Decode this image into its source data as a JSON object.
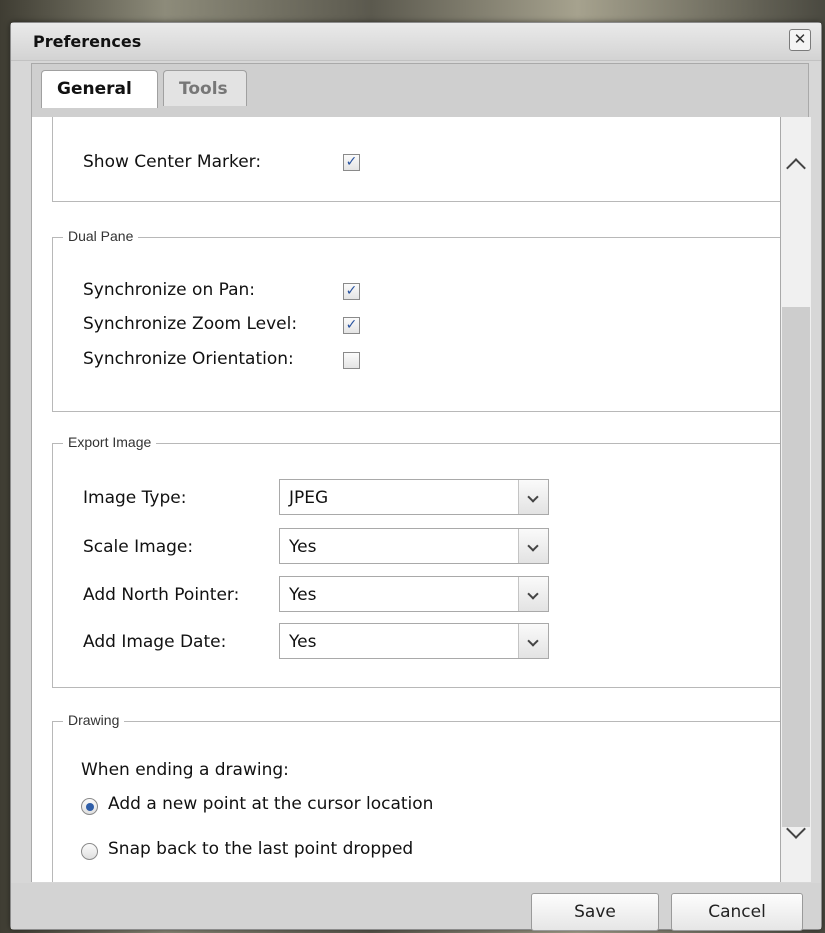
{
  "dialog": {
    "title": "Preferences",
    "close_glyph": "✕"
  },
  "tabs": [
    {
      "label": "General",
      "active": true
    },
    {
      "label": "Tools",
      "active": false
    }
  ],
  "general": {
    "show_center_marker": {
      "label": "Show Center Marker:",
      "checked": true
    }
  },
  "dual_pane": {
    "legend": "Dual Pane",
    "options": [
      {
        "label": "Synchronize on Pan:",
        "checked": true
      },
      {
        "label": "Synchronize Zoom Level:",
        "checked": true
      },
      {
        "label": "Synchronize Orientation:",
        "checked": false
      }
    ]
  },
  "export_image": {
    "legend": "Export Image",
    "fields": [
      {
        "label": "Image Type:",
        "value": "JPEG"
      },
      {
        "label": "Scale Image:",
        "value": "Yes"
      },
      {
        "label": "Add North Pointer:",
        "value": "Yes"
      },
      {
        "label": "Add Image Date:",
        "value": "Yes"
      }
    ]
  },
  "drawing": {
    "legend": "Drawing",
    "prompt": "When ending a drawing:",
    "options": [
      {
        "label": "Add a new point at the cursor location",
        "selected": true
      },
      {
        "label": "Snap back to the last point dropped",
        "selected": false
      }
    ]
  },
  "footer": {
    "save_label": "Save",
    "cancel_label": "Cancel"
  },
  "check_glyph": "✓",
  "icons": {
    "close": "close-icon",
    "scroll_up": "chevron-up-icon",
    "scroll_down": "chevron-down-icon",
    "dropdown": "chevron-down-icon"
  }
}
